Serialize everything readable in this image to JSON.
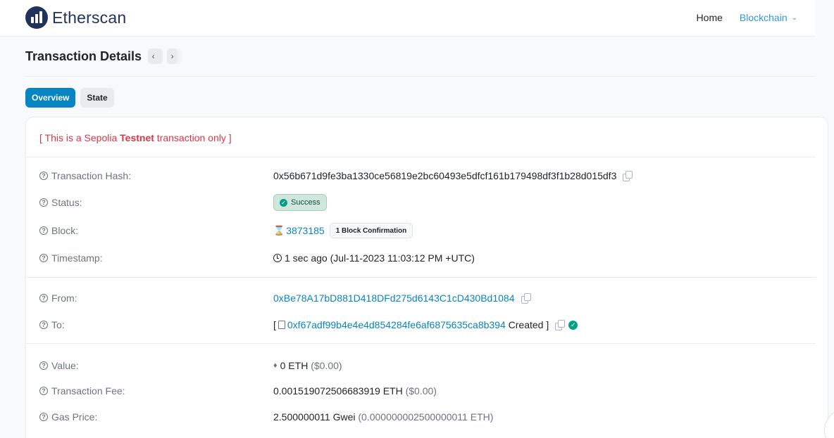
{
  "header": {
    "brand": "Etherscan",
    "nav": {
      "home": "Home",
      "blockchain": "Blockchain"
    }
  },
  "page": {
    "title": "Transaction Details"
  },
  "tabs": {
    "overview": "Overview",
    "state": "State"
  },
  "notice": {
    "prefix": "[ This is a Sepolia ",
    "bold": "Testnet",
    "suffix": " transaction only ]"
  },
  "details": {
    "tx_hash": {
      "label": "Transaction Hash:",
      "value": "0x56b671d9fe3ba1330ce56819e2bc60493e5dfcf161b179498df3f1b28d015df3"
    },
    "status": {
      "label": "Status:",
      "value": "Success"
    },
    "block": {
      "label": "Block:",
      "number": "3873185",
      "confirmations": "1 Block Confirmation"
    },
    "timestamp": {
      "label": "Timestamp:",
      "value": "1 sec ago (Jul-11-2023 11:03:12 PM +UTC)"
    },
    "from": {
      "label": "From:",
      "value": "0xBe78A17bD881D418DFd275d6143C1cD430Bd1084"
    },
    "to": {
      "label": "To:",
      "open_bracket": "[",
      "address": "0xf67adf99b4e4e4d854284fe6af6875635ca8b394",
      "created": " Created ]"
    },
    "value": {
      "label": "Value:",
      "amount": "0 ETH",
      "usd": " ($0.00)"
    },
    "fee": {
      "label": "Transaction Fee:",
      "amount": "0.001519072506683919 ETH",
      "usd": " ($0.00)"
    },
    "gas_price": {
      "label": "Gas Price:",
      "amount": "2.500000011 Gwei",
      "eth": " (0.000000002500000011 ETH)"
    }
  },
  "colors": {
    "brand": "#21325b",
    "link": "#0784c3",
    "danger": "#dc3545",
    "success": "#00a186"
  }
}
